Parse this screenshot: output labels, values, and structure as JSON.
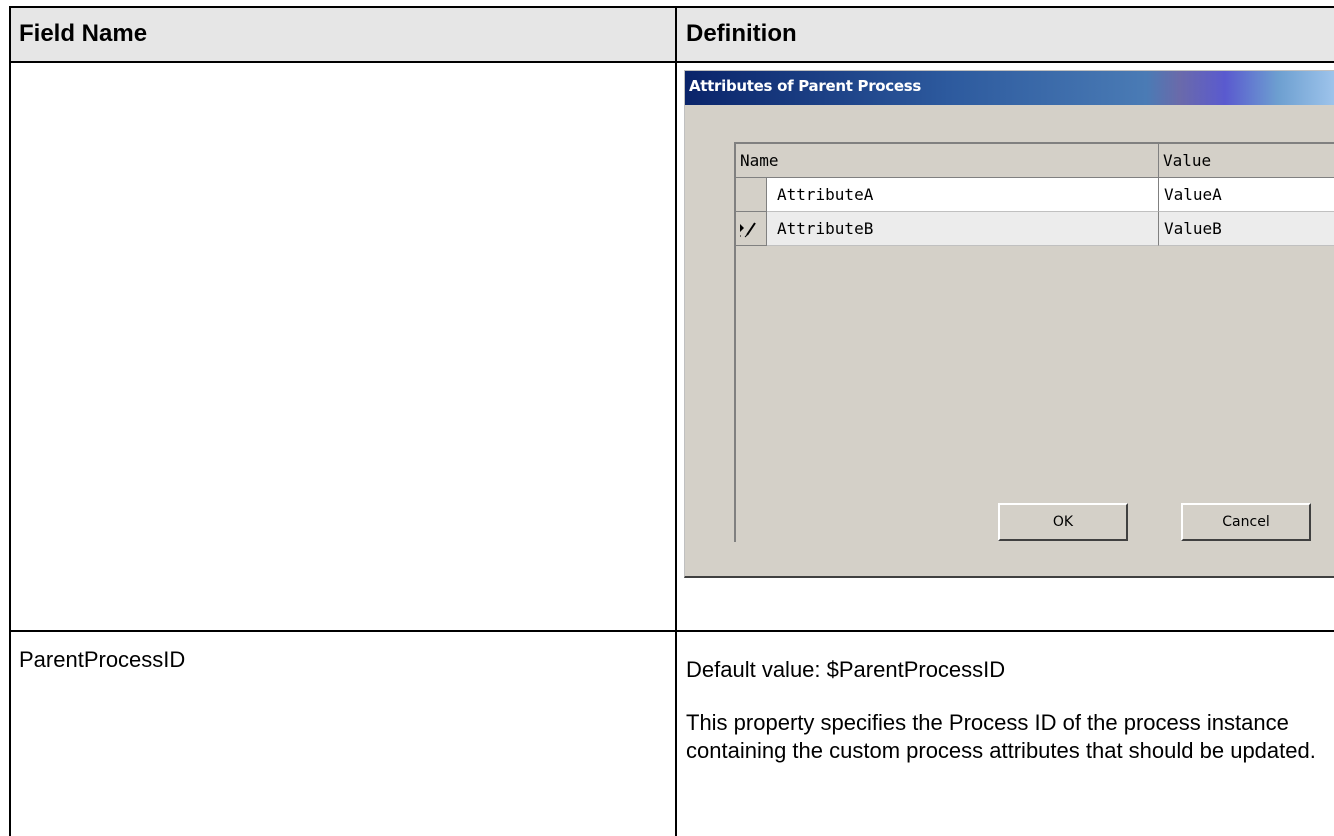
{
  "table": {
    "headers": {
      "field_name": "Field Name",
      "definition": "Definition"
    },
    "rows": [
      {
        "field_name": ""
      },
      {
        "field_name": "ParentProcessID",
        "default_value": "Default value: $ParentProcessID",
        "description": "This property specifies the Process ID of the process instance containing the custom process attributes that should be updated."
      }
    ]
  },
  "dialog": {
    "title": "Attributes of Parent Process",
    "columns": {
      "name": "Name",
      "value": "Value"
    },
    "rows": [
      {
        "name": "AttributeA",
        "value": "ValueA",
        "editing": false
      },
      {
        "name": "AttributeB",
        "value": "ValueB",
        "editing": true
      }
    ],
    "ok_label": "OK",
    "cancel_label": "Cancel"
  },
  "icons": {
    "row_edit": "pencil-edit-icon"
  },
  "colors": {
    "header_bg": "#e6e6e6",
    "dialog_bg": "#d4d0c8",
    "titlebar_start": "#0a246a",
    "titlebar_end": "#a6caf0"
  }
}
